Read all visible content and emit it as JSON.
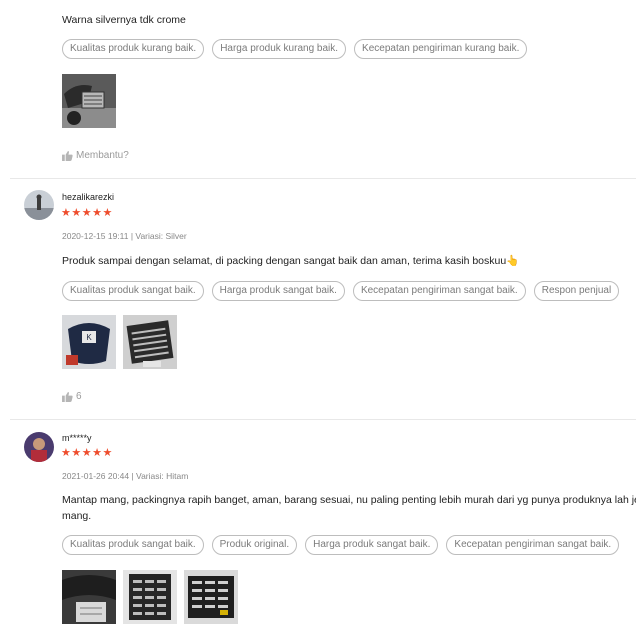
{
  "reviews": [
    {
      "text": "Warna silvernya tdk crome",
      "tags": [
        "Kualitas produk kurang baik.",
        "Harga produk kurang baik.",
        "Kecepatan pengiriman kurang baik."
      ],
      "helpful_label": "Membantu?"
    },
    {
      "username": "hezalikarezki",
      "stars": "★★★★★",
      "meta": "2020-12-15 19:11 | Variasi: Silver",
      "text": "Produk sampai dengan selamat, di packing dengan sangat baik dan aman, terima kasih boskuu👆",
      "tags": [
        "Kualitas produk sangat baik.",
        "Harga produk sangat baik.",
        "Kecepatan pengiriman sangat baik.",
        "Respon penjual"
      ],
      "helpful_count": "6"
    },
    {
      "username": "m*****y",
      "stars": "★★★★★",
      "meta": "2021-01-26 20:44 | Variasi: Hitam",
      "text_line1": "Mantap mang, packingnya rapih banget, aman, barang sesuai, nu paling penting lebih murah dari yg punya produknya lah jeung",
      "text_line2": "mang.",
      "tags": [
        "Kualitas produk sangat baik.",
        "Produk original.",
        "Harga produk sangat baik.",
        "Kecepatan pengiriman sangat baik."
      ]
    }
  ],
  "colors": {
    "star": "#ee4d2d",
    "tag_border": "#bdbdbd",
    "muted": "#888888"
  },
  "icons": {
    "helpful": "thumbs-up-icon"
  }
}
